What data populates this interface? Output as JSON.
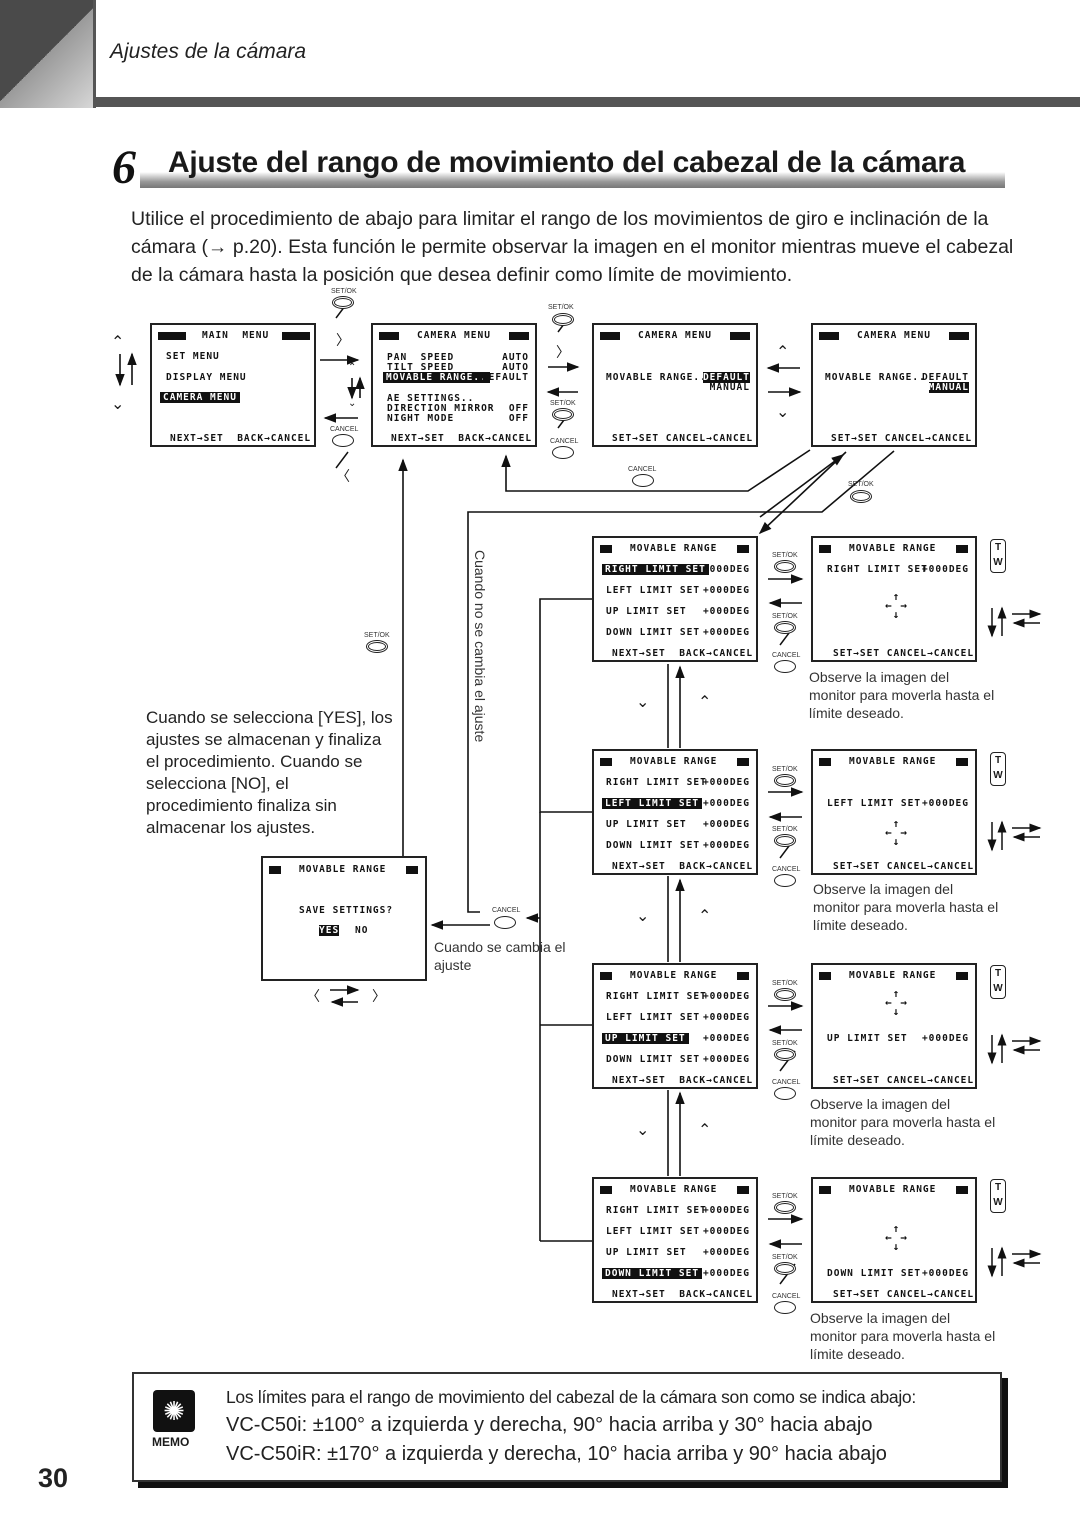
{
  "header": {
    "section": "Ajustes de la cámara"
  },
  "heading": {
    "number": "6",
    "title": "Ajuste del rango de movimiento del cabezal de la cámara"
  },
  "intro": "Utilice el procedimiento de abajo para limitar el rango de los movimientos de giro e inclinación de la cámara (→ p.20). Esta función le permite observar la imagen en el monitor mientras mueve el cabezal de la cámara hasta la posición que desea definir como límite de movimiento.",
  "buttons": {
    "setok": "SET/OK",
    "cancel": "CANCEL",
    "tele": "T",
    "wide": "W"
  },
  "screens": {
    "main_menu": {
      "title": "MAIN  MENU",
      "items": [
        "SET MENU",
        "DISPLAY MENU",
        "CAMERA MENU"
      ],
      "selected": "CAMERA MENU",
      "footer": "NEXT→SET  BACK→CANCEL"
    },
    "camera_menu": {
      "title": "CAMERA MENU",
      "rows": [
        {
          "label": "PAN  SPEED",
          "value": "AUTO"
        },
        {
          "label": "TILT SPEED",
          "value": "AUTO"
        },
        {
          "label": "MOVABLE RANGE..",
          "value": "DEFAULT"
        },
        {
          "label": "AE SETTINGS..",
          "value": ""
        },
        {
          "label": "DIRECTION MIRROR",
          "value": "OFF"
        },
        {
          "label": "NIGHT MODE",
          "value": "OFF"
        }
      ],
      "footer": "NEXT→SET  BACK→CANCEL"
    },
    "range_default": {
      "title": "CAMERA MENU",
      "label": "MOVABLE RANGE..",
      "opt1": "DEFAULT",
      "opt2": "MANUAL",
      "footer": "SET→SET CANCEL→CANCEL"
    },
    "range_manual": {
      "title": "CAMERA MENU",
      "label": "MOVABLE RANGE..",
      "opt1": "DEFAULT",
      "opt2": "MANUAL",
      "footer": "SET→SET CANCEL→CANCEL"
    },
    "save": {
      "title": "MOVABLE RANGE",
      "question": "SAVE SETTINGS?",
      "yes": "YES",
      "no": "NO"
    },
    "limits": {
      "title": "MOVABLE RANGE",
      "items": [
        {
          "label": "RIGHT LIMIT SET",
          "value": "+000DEG"
        },
        {
          "label": "LEFT LIMIT SET",
          "value": "+000DEG"
        },
        {
          "label": "UP LIMIT SET",
          "value": "+000DEG"
        },
        {
          "label": "DOWN LIMIT SET",
          "value": "+000DEG"
        }
      ],
      "footer": "NEXT→SET  BACK→CANCEL",
      "adjust_footer": "SET→SET CANCEL→CANCEL"
    }
  },
  "notes": {
    "observe": "Observe la imagen del monitor para moverla hasta el límite deseado.",
    "yes_no": "Cuando se selecciona [YES], los ajustes se almacenan y finaliza el procedimiento. Cuando se selecciona [NO], el procedimiento finaliza sin almacenar los ajustes.",
    "unchanged": "Cuando no se cambia el ajuste",
    "changed": "Cuando se cambia el ajuste"
  },
  "memo": {
    "label": "MEMO",
    "line1": "Los límites para el rango de movimiento del cabezal de la cámara son como se indica abajo:",
    "line2": "VC-C50i:    ±100° a izquierda y derecha, 90° hacia arriba y 30° hacia abajo",
    "line3": "VC-C50iR: ±170° a izquierda y derecha, 10° hacia arriba y 90° hacia abajo"
  },
  "page_number": "30"
}
